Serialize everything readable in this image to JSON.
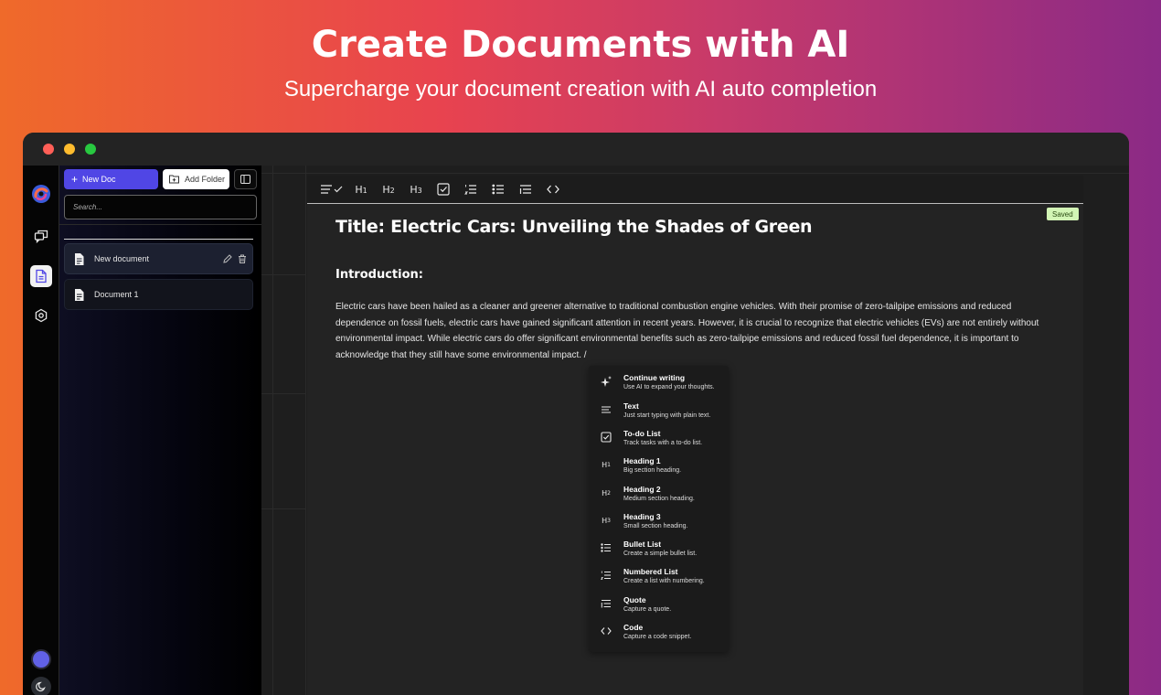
{
  "hero": {
    "title": "Create Documents with AI",
    "subtitle": "Supercharge your document creation with AI auto completion"
  },
  "colors": {
    "accent": "#5046e5",
    "saved_badge": "#d2f5b5",
    "traffic_red": "#ff5f57",
    "traffic_yellow": "#febc2e",
    "traffic_green": "#28c840"
  },
  "rail": {
    "icons": [
      "app-logo-icon",
      "chat-icon",
      "document-icon",
      "settings-icon",
      "avatar",
      "moon-icon"
    ]
  },
  "sidebar": {
    "new_doc_label": "New Doc",
    "add_folder_label": "Add Folder",
    "search_placeholder": "Search...",
    "documents": [
      {
        "label": "New document"
      },
      {
        "label": "Document 1"
      }
    ]
  },
  "toolbar": {
    "items": [
      {
        "name": "align-icon",
        "text": ""
      },
      {
        "name": "heading-1-button",
        "text": "H",
        "sub": "1"
      },
      {
        "name": "heading-2-button",
        "text": "H",
        "sub": "2"
      },
      {
        "name": "heading-3-button",
        "text": "H",
        "sub": "3"
      },
      {
        "name": "todo-list-icon",
        "text": ""
      },
      {
        "name": "numbered-list-icon",
        "text": ""
      },
      {
        "name": "bullet-list-icon",
        "text": ""
      },
      {
        "name": "quote-icon",
        "text": ""
      },
      {
        "name": "code-icon",
        "text": ""
      }
    ]
  },
  "editor": {
    "saved_label": "Saved",
    "title": "Title: Electric Cars: Unveiling the Shades of Green",
    "heading": "Introduction:",
    "body": "Electric cars have been hailed as a cleaner and greener alternative to traditional combustion engine vehicles. With their promise of zero-tailpipe emissions and reduced dependence on fossil fuels, electric cars have gained significant attention in recent years. However, it is crucial to recognize that electric vehicles (EVs) are not entirely without environmental impact. While electric cars do offer significant environmental benefits such as zero-tailpipe emissions and reduced fossil fuel dependence, it is important to acknowledge that they still have some environmental impact.  /"
  },
  "slash_menu": {
    "items": [
      {
        "title": "Continue writing",
        "desc": "Use AI to expand your thoughts.",
        "icon": "sparkle-icon"
      },
      {
        "title": "Text",
        "desc": "Just start typing with plain text.",
        "icon": "text-icon"
      },
      {
        "title": "To-do List",
        "desc": "Track tasks with a to-do list.",
        "icon": "checkbox-icon"
      },
      {
        "title": "Heading 1",
        "desc": "Big section heading.",
        "icon": "heading-1-icon"
      },
      {
        "title": "Heading 2",
        "desc": "Medium section heading.",
        "icon": "heading-2-icon"
      },
      {
        "title": "Heading 3",
        "desc": "Small section heading.",
        "icon": "heading-3-icon"
      },
      {
        "title": "Bullet List",
        "desc": "Create a simple bullet list.",
        "icon": "bullet-list-icon"
      },
      {
        "title": "Numbered List",
        "desc": "Create a list with numbering.",
        "icon": "numbered-list-icon"
      },
      {
        "title": "Quote",
        "desc": "Capture a quote.",
        "icon": "quote-icon"
      },
      {
        "title": "Code",
        "desc": "Capture a code snippet.",
        "icon": "code-icon"
      }
    ]
  }
}
